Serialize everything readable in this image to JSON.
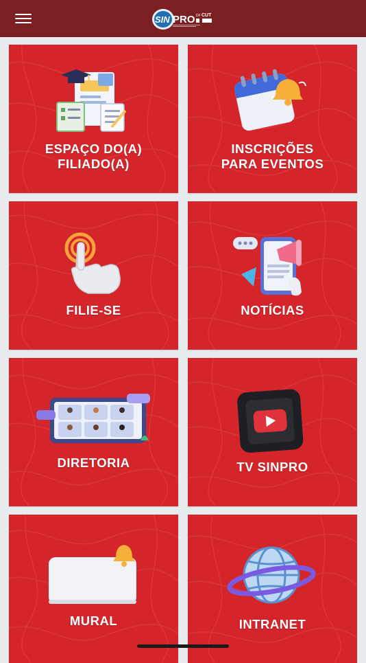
{
  "header": {
    "menu_icon": "hamburger-menu-icon",
    "logo": {
      "brand": "SINPRO",
      "region": "DF",
      "affiliation": "CUT"
    }
  },
  "tiles": [
    {
      "id": "espaco-filiado",
      "line1": "ESPAÇO DO(A)",
      "line2": "FILIADO(A)",
      "icon": "graduation-documents-icon"
    },
    {
      "id": "inscricoes-eventos",
      "line1": "INSCRIÇÕES",
      "line2": "PARA EVENTOS",
      "icon": "calendar-bell-icon"
    },
    {
      "id": "filie-se",
      "line1": "FILIE-SE",
      "line2": "",
      "icon": "tap-hand-icon"
    },
    {
      "id": "noticias",
      "line1": "NOTÍCIAS",
      "line2": "",
      "icon": "phone-megaphone-icon"
    },
    {
      "id": "diretoria",
      "line1": "DIRETORIA",
      "line2": "",
      "icon": "video-conference-icon"
    },
    {
      "id": "tv-sinpro",
      "line1": "TV SINPRO",
      "line2": "",
      "icon": "video-play-icon"
    },
    {
      "id": "mural",
      "line1": "MURAL",
      "line2": "",
      "icon": "notice-board-bell-icon"
    },
    {
      "id": "intranet",
      "line1": "INTRANET",
      "line2": "",
      "icon": "globe-ring-icon"
    }
  ],
  "colors": {
    "header_bg": "#7a1f22",
    "tile_bg": "#d4252b",
    "page_bg": "#e9ecef"
  }
}
